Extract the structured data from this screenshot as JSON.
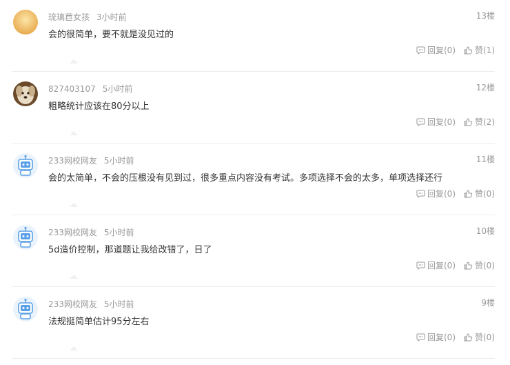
{
  "comments": [
    {
      "user": "琉璃苣女孩",
      "time": "3小时前",
      "floor": "13楼",
      "text": "会的很简单，要不就是没见过的",
      "reply": "回复(0)",
      "like": "赞(1)",
      "avatar": "gold"
    },
    {
      "user": "827403107",
      "time": "5小时前",
      "floor": "12楼",
      "text": "粗略统计应该在80分以上",
      "reply": "回复(0)",
      "like": "赞(2)",
      "avatar": "dog"
    },
    {
      "user": "233网校网友",
      "time": "5小时前",
      "floor": "11楼",
      "text": "会的太简单，不会的压根没有见到过，很多重点内容没有考试。多项选择不会的太多，单项选择还行",
      "reply": "回复(0)",
      "like": "赞(0)",
      "avatar": "robot"
    },
    {
      "user": "233网校网友",
      "time": "5小时前",
      "floor": "10楼",
      "text": "5d造价控制，那道题让我给改错了，日了",
      "reply": "回复(0)",
      "like": "赞(0)",
      "avatar": "robot"
    },
    {
      "user": "233网校网友",
      "time": "5小时前",
      "floor": "9楼",
      "text": "法规挺简单估计95分左右",
      "reply": "回复(0)",
      "like": "赞(0)",
      "avatar": "robot"
    }
  ],
  "colors": {
    "meta": "#999999",
    "text": "#333333",
    "separator": "#ececec",
    "robot": "#5aa0e6"
  }
}
